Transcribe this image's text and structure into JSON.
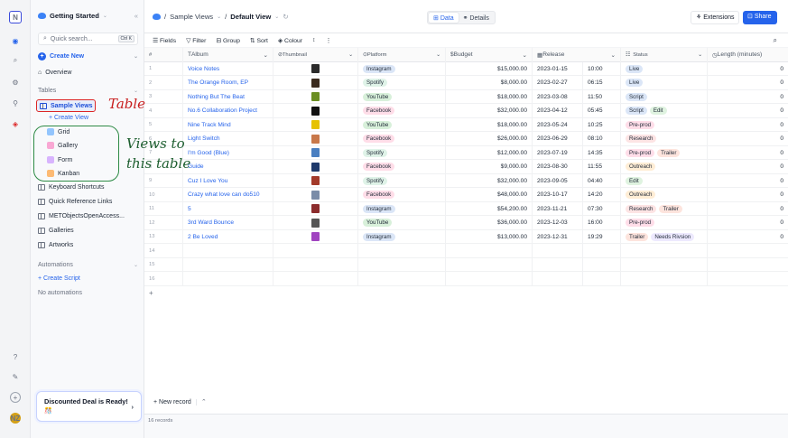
{
  "rail": {
    "logo": "N",
    "avatar": "NZ"
  },
  "sidebar": {
    "project": "Getting Started",
    "collapse": "«",
    "search_placeholder": "Quick search...",
    "search_shortcut": "Ctrl K",
    "create_new": "Create New",
    "overview": "Overview",
    "tables_label": "Tables",
    "selected_table": "Sample Views",
    "create_view": "+ Create View",
    "views": [
      {
        "label": "Grid",
        "color": "#3b82f6"
      },
      {
        "label": "Gallery",
        "color": "#ec4899"
      },
      {
        "label": "Form",
        "color": "#a855f7"
      },
      {
        "label": "Kanban",
        "color": "#f97316"
      }
    ],
    "tables": [
      "Keyboard Shortcuts",
      "Quick Reference Links",
      "METObjectsOpenAccess...",
      "Galleries",
      "Artworks"
    ],
    "automations_label": "Automations",
    "create_script": "+ Create Script",
    "no_automations": "No automations",
    "deal_title": "Discounted Deal is Ready!",
    "deal_emoji": "🎊"
  },
  "header": {
    "crumb_sep": "/",
    "crumb_base": "Sample Views",
    "crumb_view": "Default View",
    "tab_data": "Data",
    "tab_details": "Details",
    "extensions": "Extensions",
    "share": "Share"
  },
  "toolbar": {
    "fields": "Fields",
    "filter": "Filter",
    "group": "Group",
    "sort": "Sort",
    "colour": "Colour"
  },
  "columns": [
    "#",
    "Album",
    "Thumbnail",
    "Platform",
    "Budget",
    "Release",
    "Status",
    "Length (minutes)"
  ],
  "platform_colors": {
    "Instagram": "#dbe6f7",
    "Spotify": "#dff3e8",
    "YouTube": "#d8f0da",
    "Facebook": "#ffdde8"
  },
  "status_colors": {
    "Live": "#dbe6f7",
    "Script": "#dbe6f7",
    "Edit": "#dff3e0",
    "Pre-prod": "#ffdde8",
    "Research": "#fde4e4",
    "Trailer": "#fde4dd",
    "Outreach": "#ffedd5",
    "Needs Rivsion": "#ede9fe"
  },
  "rows": [
    {
      "n": "1",
      "album": "Voice Notes",
      "thumb": "#2b2b2b",
      "platform": "Instagram",
      "budget": "$15,000.00",
      "date": "2023-01-15",
      "time": "10:00",
      "status": [
        "Live"
      ],
      "length": "0"
    },
    {
      "n": "2",
      "album": "The Orange Room, EP",
      "thumb": "#3a2a1e",
      "platform": "Spotify",
      "budget": "$8,000.00",
      "date": "2023-02-27",
      "time": "06:15",
      "status": [
        "Live"
      ],
      "length": "0"
    },
    {
      "n": "3",
      "album": "Nothing But The Beat",
      "thumb": "#6b8e23",
      "platform": "YouTube",
      "budget": "$18,000.00",
      "date": "2023-03-08",
      "time": "11:50",
      "status": [
        "Script"
      ],
      "length": "0"
    },
    {
      "n": "4",
      "album": "No.6 Collaboration Project",
      "thumb": "#111111",
      "platform": "Facebook",
      "budget": "$32,000.00",
      "date": "2023-04-12",
      "time": "05:45",
      "status": [
        "Script",
        "Edit"
      ],
      "length": "0"
    },
    {
      "n": "5",
      "album": "Nine Track Mind",
      "thumb": "#e6c200",
      "platform": "YouTube",
      "budget": "$18,000.00",
      "date": "2023-05-24",
      "time": "10:25",
      "status": [
        "Pre-prod"
      ],
      "length": "0"
    },
    {
      "n": "6",
      "album": "Light Switch",
      "thumb": "#c8784a",
      "platform": "Facebook",
      "budget": "$26,000.00",
      "date": "2023-06-29",
      "time": "08:10",
      "status": [
        "Research"
      ],
      "length": "0"
    },
    {
      "n": "7",
      "album": "I'm Good (Blue)",
      "thumb": "#4a7fc1",
      "platform": "Spotify",
      "budget": "$12,000.00",
      "date": "2023-07-19",
      "time": "14:35",
      "status": [
        "Pre-prod",
        "Trailer"
      ],
      "length": "0"
    },
    {
      "n": "8",
      "album": "Guide",
      "thumb": "#1f3a6b",
      "platform": "Facebook",
      "budget": "$9,000.00",
      "date": "2023-08-30",
      "time": "11:55",
      "status": [
        "Outreach"
      ],
      "length": "0"
    },
    {
      "n": "9",
      "album": "Cuz I Love You",
      "thumb": "#a33a2a",
      "platform": "Spotify",
      "budget": "$32,000.00",
      "date": "2023-09-05",
      "time": "04:40",
      "status": [
        "Edit"
      ],
      "length": "0"
    },
    {
      "n": "10",
      "album": "Crazy what love can do510",
      "thumb": "#7a8ca8",
      "platform": "Facebook",
      "budget": "$48,000.00",
      "date": "2023-10-17",
      "time": "14:20",
      "status": [
        "Outreach"
      ],
      "length": "0"
    },
    {
      "n": "11",
      "album": "5",
      "thumb": "#8b2c2c",
      "platform": "Instagram",
      "budget": "$54,200.00",
      "date": "2023-11-21",
      "time": "07:30",
      "status": [
        "Research",
        "Trailer"
      ],
      "length": "0"
    },
    {
      "n": "12",
      "album": "3rd Ward Bounce",
      "thumb": "#555555",
      "platform": "YouTube",
      "budget": "$36,000.00",
      "date": "2023-12-03",
      "time": "16:00",
      "status": [
        "Pre-prod"
      ],
      "length": "0"
    },
    {
      "n": "13",
      "album": "2 Be Loved",
      "thumb": "#a044c0",
      "platform": "Instagram",
      "budget": "$13,000.00",
      "date": "2023-12-31",
      "time": "19:29",
      "status": [
        "Trailer",
        "Needs Rivsion"
      ],
      "length": "0"
    },
    {
      "n": "14"
    },
    {
      "n": "15"
    },
    {
      "n": "16"
    }
  ],
  "add_row": "+",
  "new_record": "+ New record",
  "records_count": "16 records",
  "annotations": {
    "table": "Table",
    "views_line1": "Views to",
    "views_line2": "this table"
  }
}
